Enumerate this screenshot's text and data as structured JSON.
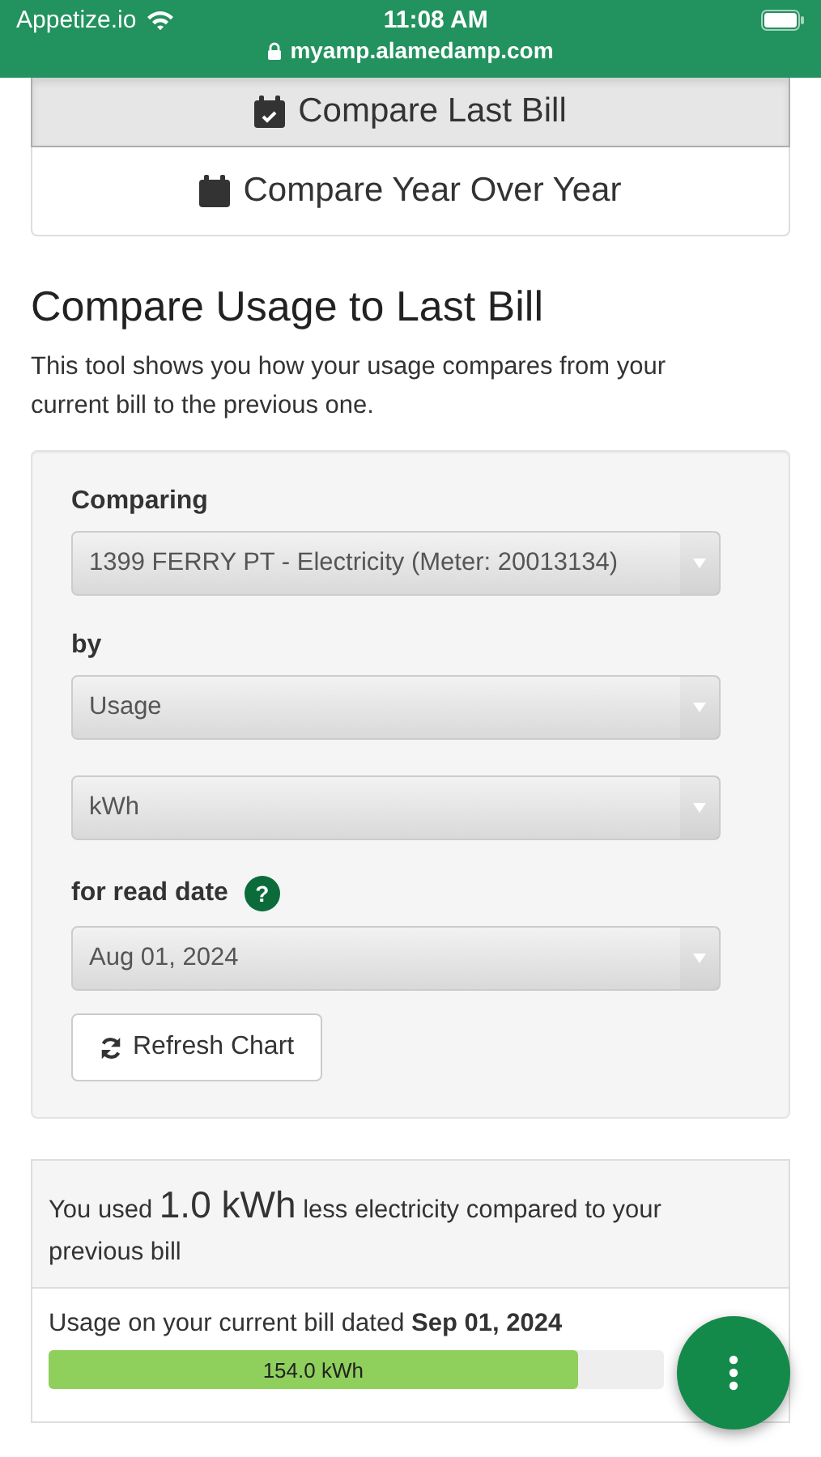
{
  "status_bar": {
    "carrier": "Appetize.io",
    "time": "11:08 AM",
    "url": "myamp.alamedamp.com"
  },
  "tabs": [
    {
      "label": "Compare Last Bill",
      "kind": "check",
      "selected": true
    },
    {
      "label": "Compare Year Over Year",
      "kind": "plain",
      "selected": false
    }
  ],
  "heading": "Compare Usage to Last Bill",
  "intro": "This tool shows you how your usage compares from your current bill to the previous one.",
  "form": {
    "fields": [
      {
        "label": "Comparing",
        "value": "1399 FERRY PT - Electricity (Meter: 20013134)"
      },
      {
        "label": "by",
        "value": "Usage"
      },
      {
        "value": "kWh"
      },
      {
        "label": "for read date",
        "value": "Aug 01, 2024",
        "help": "?"
      }
    ],
    "refresh_button": "Refresh Chart"
  },
  "result": {
    "summary_prefix": "You used ",
    "summary_amount": "1.0 kWh",
    "summary_suffix": " less electricity compared to your previous bill",
    "current_label": "Usage on your current bill dated **Sep 01, 2024**",
    "current_value": "154.0 kWh",
    "level": 0.86
  }
}
